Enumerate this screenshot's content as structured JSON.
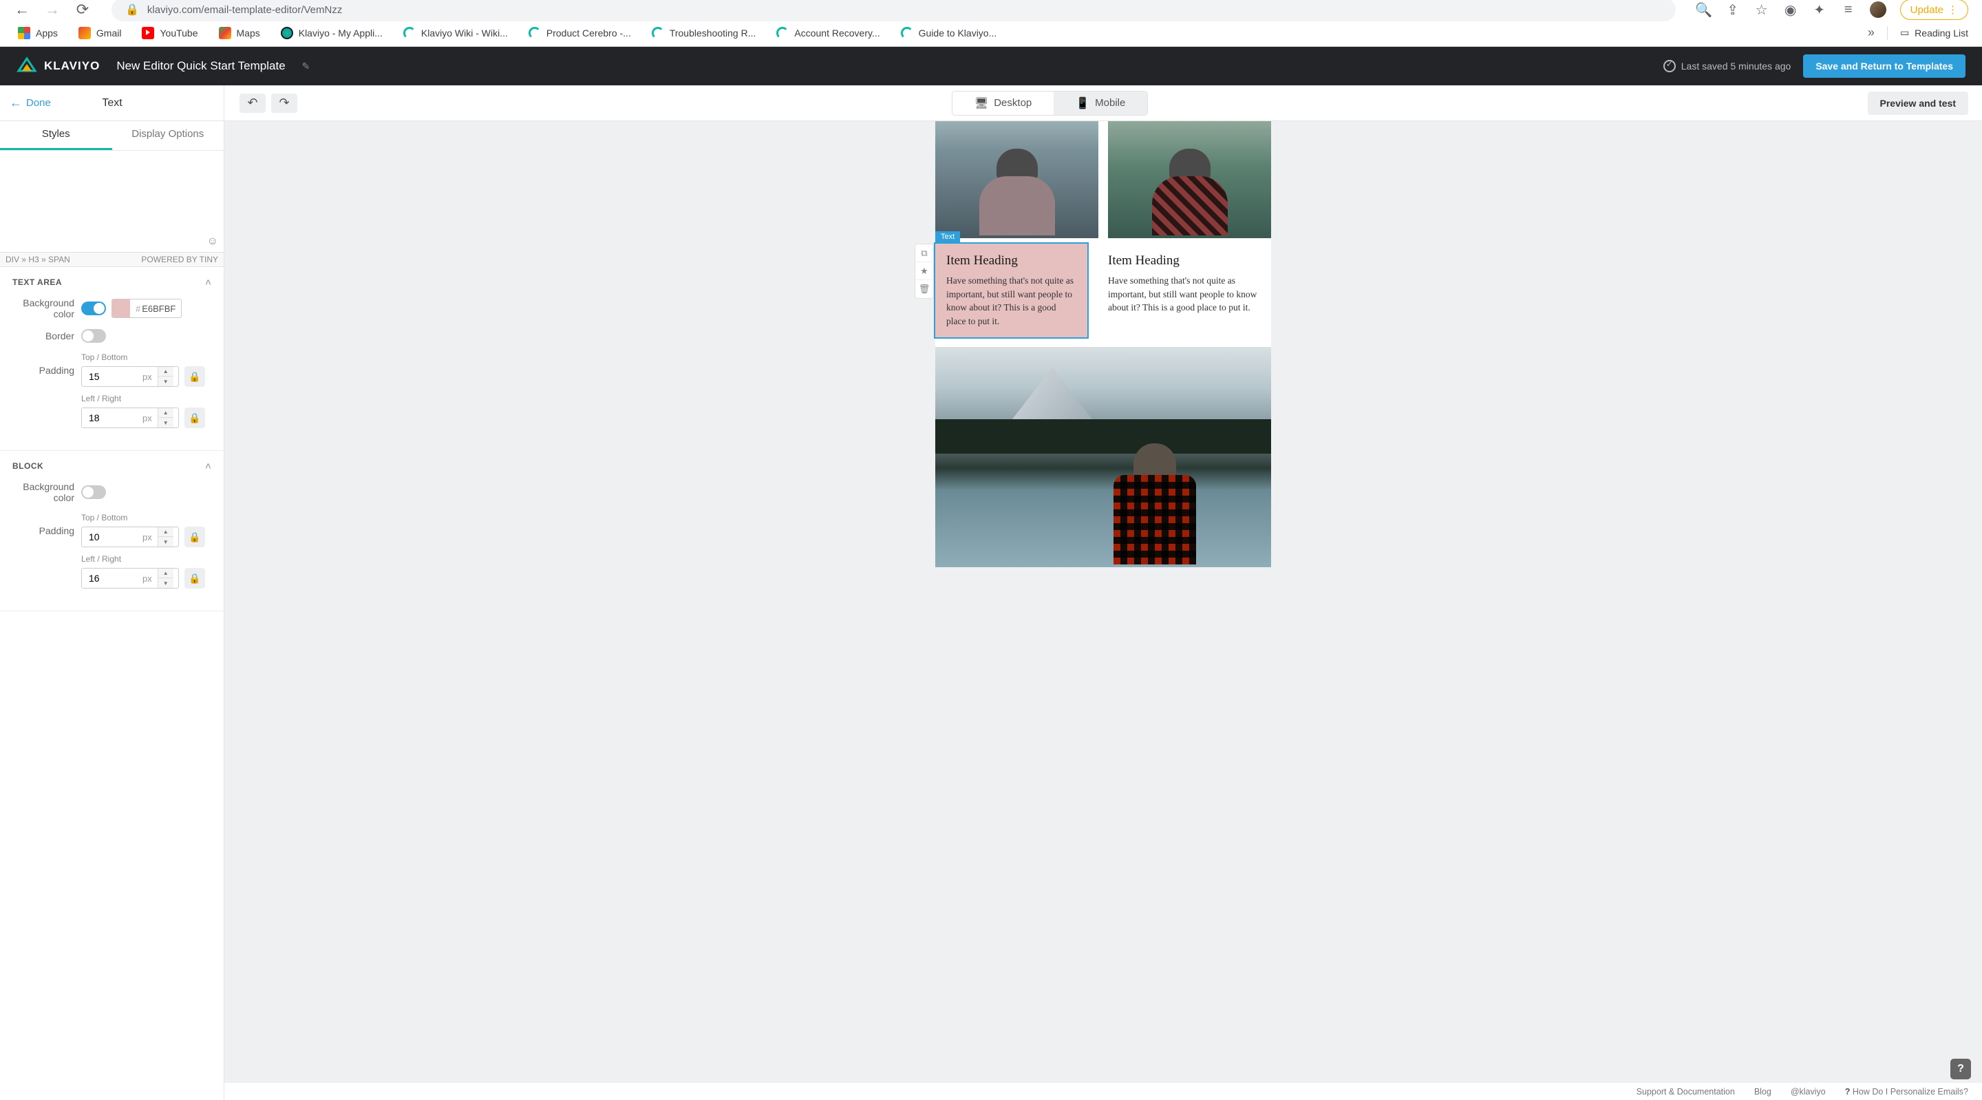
{
  "browser": {
    "url": "klaviyo.com/email-template-editor/VemNzz",
    "update_label": "Update",
    "bookmarks": [
      {
        "label": "Apps"
      },
      {
        "label": "Gmail"
      },
      {
        "label": "YouTube"
      },
      {
        "label": "Maps"
      },
      {
        "label": "Klaviyo - My Appli..."
      },
      {
        "label": "Klaviyo Wiki - Wiki..."
      },
      {
        "label": "Product Cerebro -..."
      },
      {
        "label": "Troubleshooting R..."
      },
      {
        "label": "Account Recovery..."
      },
      {
        "label": "Guide to Klaviyo..."
      }
    ],
    "reading_list": "Reading List"
  },
  "header": {
    "brand": "KLAVIYO",
    "template_title": "New Editor Quick Start Template",
    "save_status": "Last saved 5 minutes ago",
    "save_return": "Save and Return to Templates"
  },
  "toolbar": {
    "done": "Done",
    "panel_title": "Text",
    "desktop": "Desktop",
    "mobile": "Mobile",
    "preview": "Preview and test"
  },
  "sidebar": {
    "tabs": {
      "styles": "Styles",
      "display_options": "Display Options"
    },
    "breadcrumb": "DIV » H3 » SPAN",
    "powered": "POWERED BY TINY",
    "text_area": {
      "title": "TEXT AREA",
      "bg_label": "Background color",
      "bg_hex": "E6BFBF",
      "border_label": "Border",
      "padding_label": "Padding",
      "tb_label": "Top / Bottom",
      "tb_value": "15",
      "lr_label": "Left / Right",
      "lr_value": "18",
      "unit": "px"
    },
    "block": {
      "title": "BLOCK",
      "bg_label": "Background color",
      "padding_label": "Padding",
      "tb_label": "Top / Bottom",
      "tb_value": "10",
      "lr_label": "Left / Right",
      "lr_value": "16",
      "unit": "px"
    }
  },
  "canvas": {
    "selected_tag": "Text",
    "item1": {
      "heading": "Item Heading",
      "body": "Have something that's not quite as important, but still want people to know about it? This is a good place to put it."
    },
    "item2": {
      "heading": "Item Heading",
      "body": "Have something that's not quite as important, but still want people to know about it? This is a good place to put it."
    }
  },
  "footer": {
    "support": "Support & Documentation",
    "blog": "Blog",
    "handle": "@klaviyo",
    "personalize": "How Do I Personalize Emails?"
  }
}
